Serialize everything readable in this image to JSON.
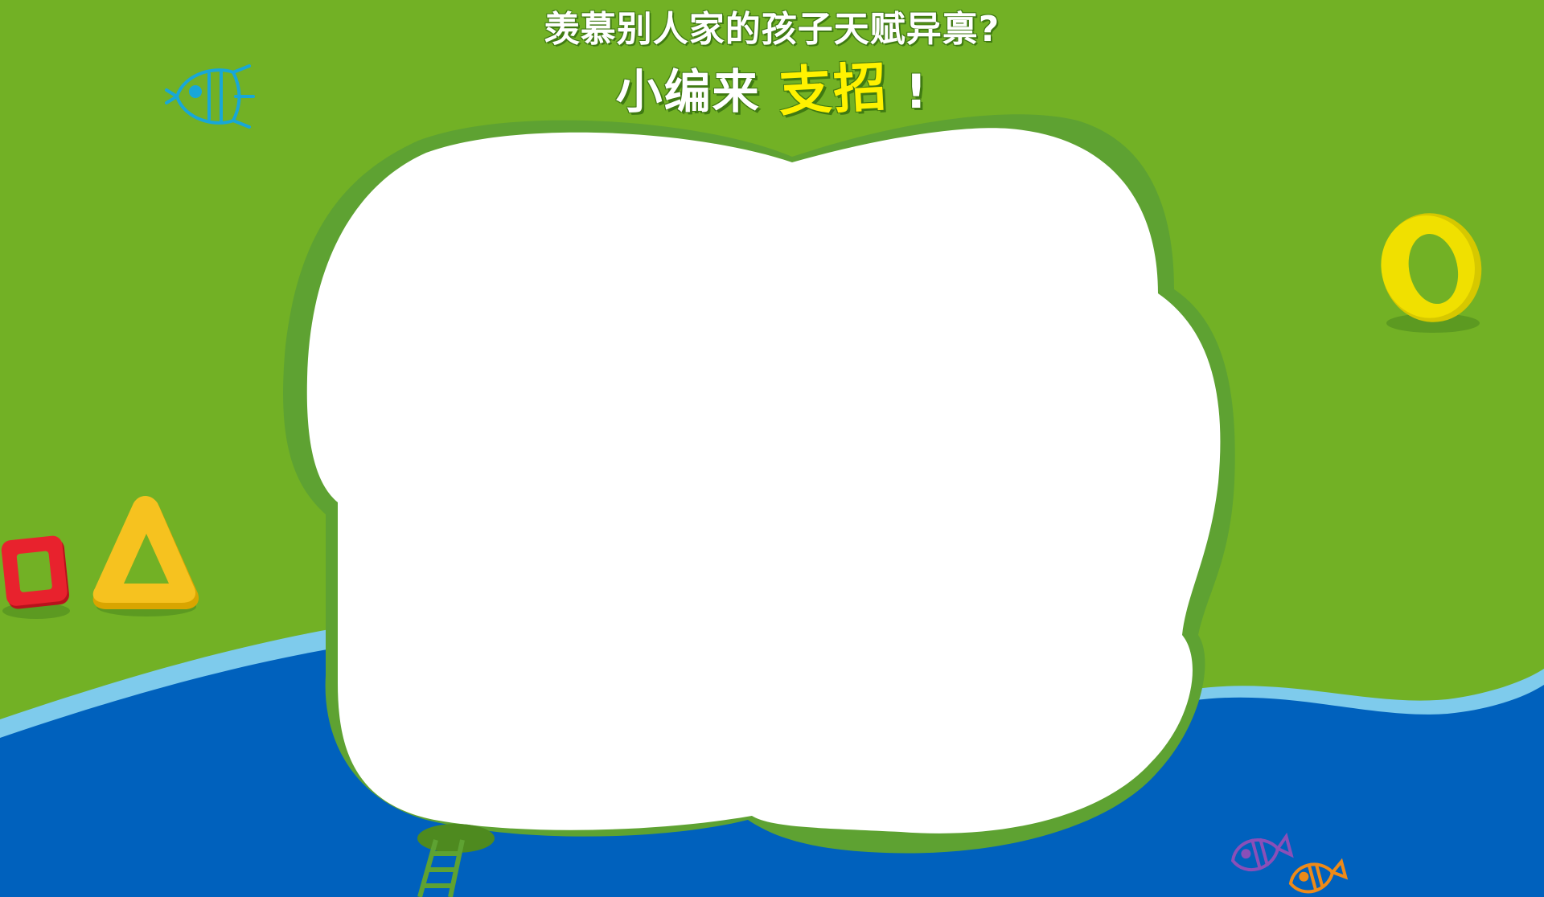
{
  "headline": {
    "line1": "羡慕别人家的孩子天赋异禀?",
    "line2_prefix": "小编来",
    "line2_highlight": "支招",
    "line2_suffix": "!"
  },
  "colors": {
    "grass": "#72b125",
    "grass_shadow": "#5ea232",
    "sea": "#0061bd",
    "sea_edge": "#7ecbec",
    "panel": "#ffffff",
    "ring_yellow": "#f0e000",
    "triangle_yellow": "#f6c21f",
    "square_red": "#e8222d",
    "fish_blue": "#18a7d8",
    "fish_purple": "#8a4fb8",
    "fish_orange": "#ee8a18"
  },
  "decorations": [
    "fish-icon",
    "ring-icon",
    "square-frame-icon",
    "triangle-frame-icon",
    "ladder-icon"
  ]
}
